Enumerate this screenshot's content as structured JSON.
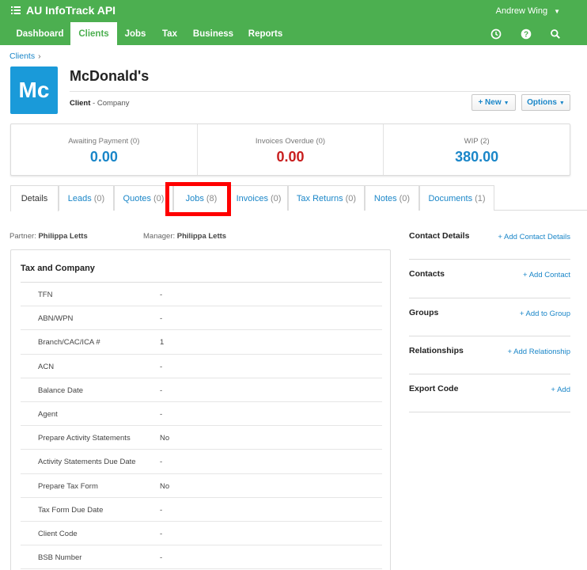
{
  "app": {
    "title": "AU InfoTrack API",
    "user": "Andrew Wing"
  },
  "nav": {
    "items": [
      {
        "label": "Dashboard",
        "active": false
      },
      {
        "label": "Clients",
        "active": true
      },
      {
        "label": "Jobs",
        "active": false
      },
      {
        "label": "Tax",
        "active": false
      },
      {
        "label": "Business",
        "active": false
      },
      {
        "label": "Reports",
        "active": false
      }
    ],
    "icons": [
      "clock-icon",
      "help-icon",
      "search-icon"
    ]
  },
  "breadcrumb": {
    "root": "Clients",
    "separator": "›"
  },
  "client": {
    "initials": "Mc",
    "name": "McDonald's",
    "type_label": "Client",
    "type_detail": " - Company"
  },
  "buttons": {
    "new": "+ New",
    "options": "Options"
  },
  "summary": [
    {
      "label": "Awaiting Payment (0)",
      "value": "0.00",
      "color": "#1a86c8"
    },
    {
      "label": "Invoices Overdue (0)",
      "value": "0.00",
      "color": "#c81e1e"
    },
    {
      "label": "WIP (2)",
      "value": "380.00",
      "color": "#1a86c8"
    }
  ],
  "tabs": [
    {
      "label": "Details",
      "count": "",
      "active": true
    },
    {
      "label": "Leads",
      "count": "(0)"
    },
    {
      "label": "Quotes",
      "count": "(0)"
    },
    {
      "label": "Jobs",
      "count": "(8)"
    },
    {
      "label": "Invoices",
      "count": "(0)"
    },
    {
      "label": "Tax Returns",
      "count": "(0)"
    },
    {
      "label": "Notes",
      "count": "(0)"
    },
    {
      "label": "Documents",
      "count": "(1)"
    }
  ],
  "staff": {
    "partner_label": "Partner:",
    "partner": "Philippa Letts",
    "manager_label": "Manager:",
    "manager": "Philippa Letts"
  },
  "tax_panel": {
    "title": "Tax and Company",
    "rows": [
      {
        "key": "TFN",
        "value": "-"
      },
      {
        "key": "ABN/WPN",
        "value": "-"
      },
      {
        "key": "Branch/CAC/ICA #",
        "value": "1"
      },
      {
        "key": "ACN",
        "value": "-"
      },
      {
        "key": "Balance Date",
        "value": "-"
      },
      {
        "key": "Agent",
        "value": "-"
      },
      {
        "key": "Prepare Activity Statements",
        "value": "No"
      },
      {
        "key": "Activity Statements Due Date",
        "value": "-"
      },
      {
        "key": "Prepare Tax Form",
        "value": "No"
      },
      {
        "key": "Tax Form Due Date",
        "value": "-"
      },
      {
        "key": "Client Code",
        "value": "-"
      },
      {
        "key": "BSB Number",
        "value": "-"
      }
    ]
  },
  "side": [
    {
      "title": "Contact Details",
      "link": "+ Add Contact Details"
    },
    {
      "title": "Contacts",
      "link": "+ Add Contact"
    },
    {
      "title": "Groups",
      "link": "+ Add to Group"
    },
    {
      "title": "Relationships",
      "link": "+ Add Relationship"
    },
    {
      "title": "Export Code",
      "link": "+ Add"
    }
  ]
}
